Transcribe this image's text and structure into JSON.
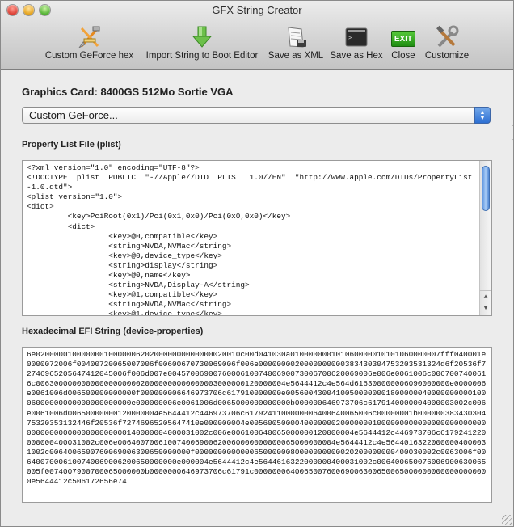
{
  "window": {
    "title": "GFX String Creator"
  },
  "toolbar": {
    "items": [
      {
        "label": "Custom GeForce hex",
        "icon": "build-tools-icon"
      },
      {
        "label": "Import String to Boot Editor",
        "icon": "green-down-arrow-icon"
      },
      {
        "label": "Save as XML",
        "icon": "document-save-icon"
      },
      {
        "label": "Save as Hex",
        "icon": "terminal-icon"
      },
      {
        "label": "Close",
        "icon": "exit-icon",
        "badge": "EXIT"
      },
      {
        "label": "Customize",
        "icon": "tools-icon"
      }
    ]
  },
  "graphics_card": {
    "label": "Graphics Card: 8400GS 512Mo Sortie VGA",
    "selected": "Custom GeForce..."
  },
  "plist": {
    "label": "Property List File (plist)",
    "lines": [
      "<?xml version=\"1.0\" encoding=\"UTF-8\"?>",
      "<!DOCTYPE  plist  PUBLIC  \"-//Apple//DTD  PLIST  1.0//EN\"  \"http://www.apple.com/DTDs/PropertyList-1.0.dtd\">",
      "<plist version=\"1.0\">",
      "<dict>",
      "         <key>PciRoot(0x1)/Pci(0x1,0x0)/Pci(0x0,0x0)</key>",
      "         <dict>",
      "                  <key>@0,compatible</key>",
      "                  <string>NVDA,NVMac</string>",
      "                  <key>@0,device_type</key>",
      "                  <string>display</string>",
      "                  <key>@0,name</key>",
      "                  <string>NVDA,Display-A</string>",
      "                  <key>@1,compatible</key>",
      "                  <string>NVDA,NVMac</string>",
      "                  <key>@1,device_type</key>"
    ]
  },
  "efi": {
    "label": "Hexadecimal EFI String (device-properties)",
    "value": "6e020000010000000100000062020000000000000020010c00d041030a010000000101060000010101060000007fff040001e0000072006f00400720065007006f00600670730069006f006e0000000020000000000383430304753203531324d6f20536f72746965205647412045006f006d007e004570069007600061007400690073006700620069006e006e0061006c0067007400616c0063000000000000000000020000000000000003000000120000004e5644412c4e564d616300000006090000000e0000006e0061006d006500000000000f000000006646973706c617910000000e0056004300410050000000180000004000000000010006000000000000000000000e000000006e0061006d0065000000000000b000000646973706c6179140000004000003002c006e0061006d00650000000120000004e5644412c446973706c6179241100000006400640065006c00000001b00000038343030475320353132446f20536f72746965205647410e000000004e00560050000400000002000000010000000000000000000000000000000000000000000000140000004000031002c006e006100640065000000120000004e5644412c446973706c6179241220000000400031002c006e006400700610074006900620060000000000065000000004e5644412c4e56440163220000004000031002c0064006500760069006300650000000f00000000000006500000080000000000020200000000400030002c0063006f00640070006100740069006200650000000e000004e5644412c4e5644616322000000400031002c006400650076006900630065005f0074007900700065000000b0000000646973706c61791c0000000640065007600690063006500650000000000000000000e5644412c506172656e74"
  },
  "colors": {
    "accent_blue": "#2d6fd3",
    "window_bg": "#ececec",
    "close_red": "#e0463b",
    "minimize_yellow": "#e8a825",
    "zoom_green": "#5bb83b"
  }
}
